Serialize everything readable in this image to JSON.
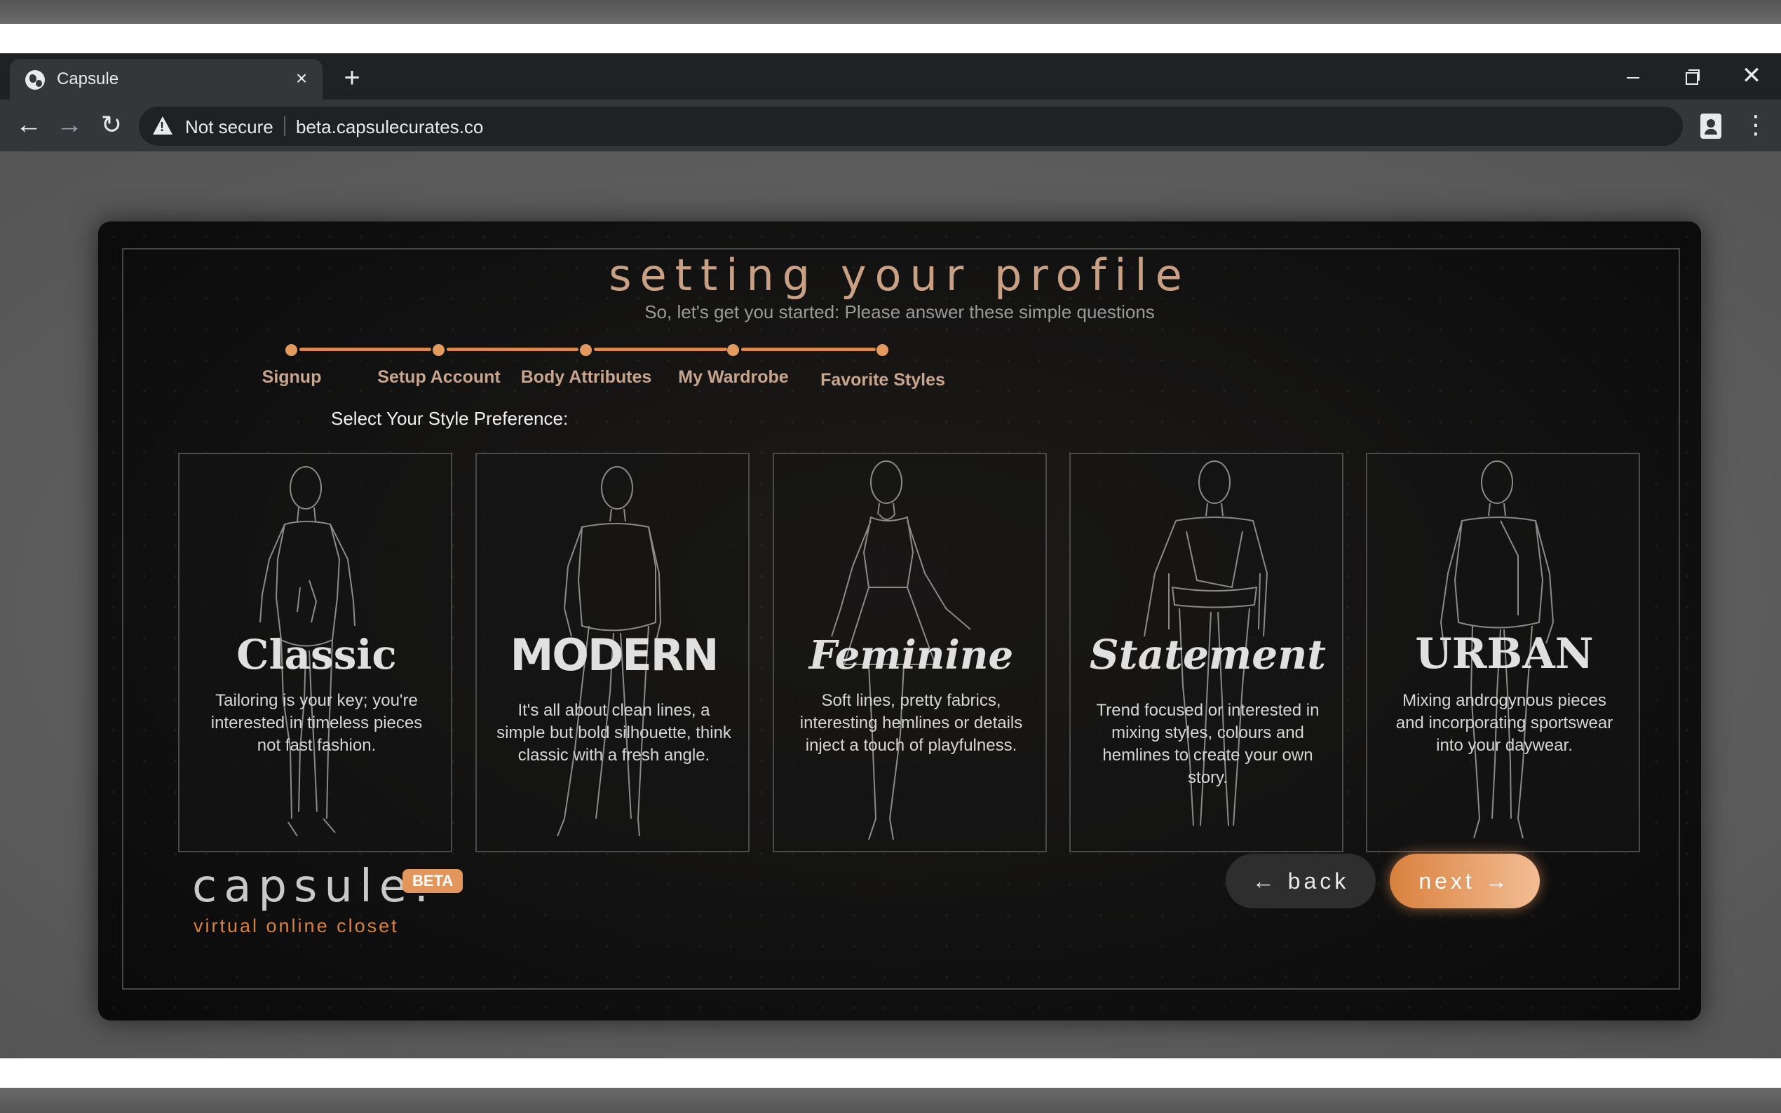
{
  "browser": {
    "tab_title": "Capsule",
    "tab_close": "×",
    "new_tab": "+",
    "security_label": "Not secure",
    "url": "beta.capsulecurates.co",
    "window_close": "✕",
    "nav_back": "←",
    "nav_forward": "→",
    "nav_reload": "↻",
    "menu": "⋮"
  },
  "page": {
    "title": "setting your profile",
    "subtitle": "So, let's get you started: Please answer these simple questions",
    "steps": [
      {
        "label": "Signup"
      },
      {
        "label": "Setup Account"
      },
      {
        "label": "Body Attributes"
      },
      {
        "label": "My Wardrobe"
      },
      {
        "label": "Favorite Styles"
      }
    ],
    "preference_label": "Select Your Style Preference:",
    "styles": [
      {
        "name": "Classic",
        "description": "Tailoring is your key; you're interested in timeless pieces not fast fashion."
      },
      {
        "name": "MODERN",
        "description": "It's all about clean lines, a simple but bold silhouette, think classic with a fresh angle."
      },
      {
        "name": "Feminine",
        "description": "Soft lines, pretty fabrics, interesting hemlines or details inject a touch of playfulness."
      },
      {
        "name": "Statement",
        "description": "Trend focused or interested in mixing styles, colours and hemlines to create your own story."
      },
      {
        "name": "URBAN",
        "description": "Mixing androgynous pieces and incorporating sportswear into your daywear."
      }
    ],
    "brand": {
      "name": "capsule:",
      "badge": "BETA",
      "tagline": "virtual online closet"
    },
    "buttons": {
      "back": "← back",
      "next": "next →"
    }
  },
  "colors": {
    "accent": "#d98b4e",
    "chrome_dark": "#202124",
    "chrome_toolbar": "#35363a",
    "modal_bg": "#0d0d0d"
  }
}
